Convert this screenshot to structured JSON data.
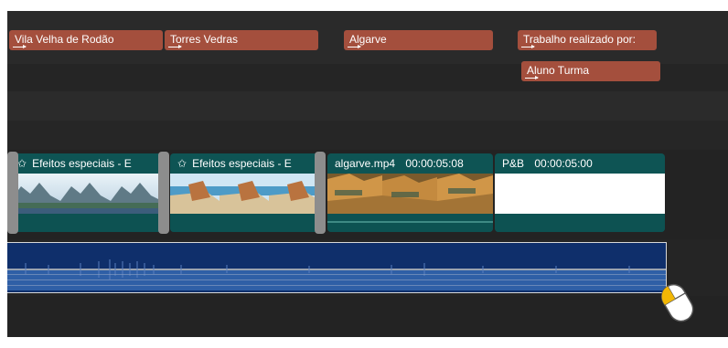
{
  "title_clips": [
    {
      "label": "Vila Velha de Rodão"
    },
    {
      "label": "Torres Vedras"
    },
    {
      "label": "Algarve"
    },
    {
      "label": "Trabalho realizado por:"
    },
    {
      "label": "Aluno Turma"
    }
  ],
  "video_clips": [
    {
      "label": "Efeitos especiais - E",
      "icon": "star-effect-icon"
    },
    {
      "label": "Efeitos especiais - E",
      "icon": "star-effect-icon"
    },
    {
      "label": "algarve.mp4",
      "duration": "00:00:05:08"
    },
    {
      "label": "P&B",
      "duration": "00:00:05:00"
    }
  ],
  "colors": {
    "title_clip": "#a44f3d",
    "video_clip": "#0e5454",
    "audio_clip": "#0f2f6b",
    "timeline_bg": "#262626"
  }
}
